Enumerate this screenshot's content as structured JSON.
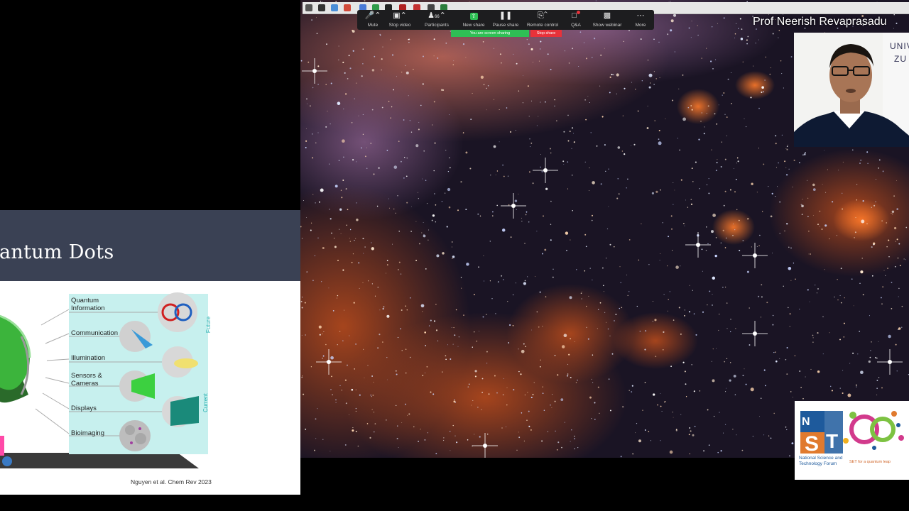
{
  "slide": {
    "title": "antum Dots",
    "labels": [
      "Quantum Information",
      "Communication",
      "Illumination",
      "Sensors & Cameras",
      "Displays",
      "Bioimaging"
    ],
    "label_lines": [
      [
        "Quantum",
        "Information"
      ],
      [
        "Communication"
      ],
      [
        "Illumination"
      ],
      [
        "Sensors &",
        "Cameras"
      ],
      [
        "Displays"
      ],
      [
        "Bioimaging"
      ]
    ],
    "future_label": "Future",
    "current_label": "Current",
    "citation": "Nguyen et al. Chem Rev 2023"
  },
  "toolbar": {
    "items": [
      {
        "label": "Mute",
        "icon": "microphone-icon"
      },
      {
        "label": "Stop video",
        "icon": "video-camera-icon"
      },
      {
        "label": "Participants",
        "icon": "participants-icon",
        "count": "66"
      },
      {
        "label": "New share",
        "icon": "share-arrow-icon"
      },
      {
        "label": "Pause share",
        "icon": "pause-icon"
      },
      {
        "label": "Remote control",
        "icon": "remote-control-icon"
      },
      {
        "label": "Q&A",
        "icon": "qa-icon"
      },
      {
        "label": "Show webinar",
        "icon": "webinar-icon"
      },
      {
        "label": "More",
        "icon": "more-icon"
      }
    ],
    "sharing_text": "You are screen sharing",
    "stop_share": "Stop share"
  },
  "presenter": {
    "name": "Prof Neerish Revaprasadu",
    "background_text": [
      "UNIV",
      "ZU"
    ]
  },
  "logo": {
    "org_name_line1": "National Science and",
    "org_name_line2": "Technology Forum",
    "tagline": "SET for a quantum leap",
    "colors": {
      "blue": "#1e5a9c",
      "orange": "#e07a2e",
      "green": "#7dc242",
      "pink": "#d23a8c"
    }
  },
  "colors": {
    "slide_header": "#3a4154",
    "zoom_green": "#2fbf55",
    "zoom_red": "#e8323a",
    "toolbar_bg": "#1d1d1f"
  }
}
